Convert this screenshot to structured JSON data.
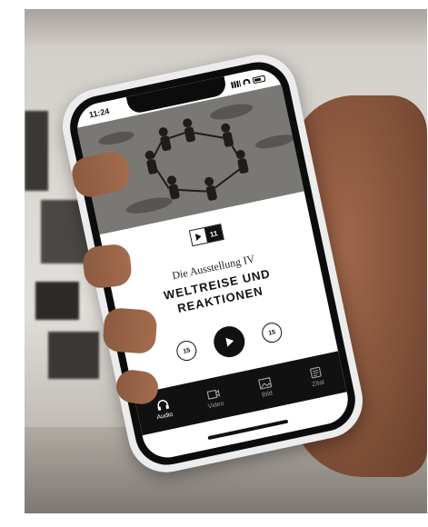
{
  "status_bar": {
    "time": "11:24"
  },
  "track": {
    "number": "11"
  },
  "chapter": {
    "subtitle": "Die Ausstellung IV",
    "title_line1": "WELTREISE UND",
    "title_line2": "REAKTIONEN"
  },
  "player": {
    "rewind_label": "15",
    "forward_label": "15"
  },
  "tabs": [
    {
      "label": "Audio",
      "icon": "headphones-icon",
      "active": true
    },
    {
      "label": "Video",
      "icon": "video-icon",
      "active": false
    },
    {
      "label": "Bild",
      "icon": "image-icon",
      "active": false
    },
    {
      "label": "Zitat",
      "icon": "quote-icon",
      "active": false
    }
  ]
}
